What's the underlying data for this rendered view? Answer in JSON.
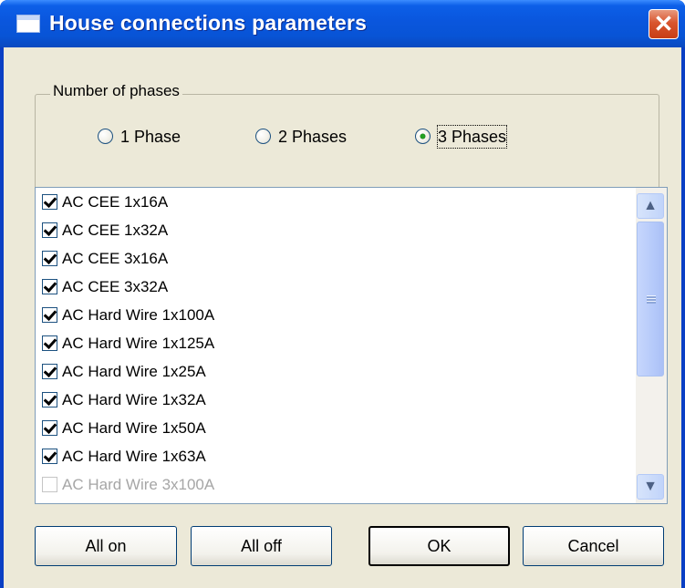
{
  "window": {
    "title": "House connections parameters",
    "close_glyph": "✕",
    "icon": "window-app-icon"
  },
  "phases": {
    "legend": "Number of phases",
    "options": [
      {
        "label": "1 Phase",
        "checked": false
      },
      {
        "label": "2 Phases",
        "checked": false
      },
      {
        "label": "3 Phases",
        "checked": true
      }
    ]
  },
  "list": {
    "items": [
      {
        "label": "AC CEE 1x16A",
        "checked": true
      },
      {
        "label": "AC CEE 1x32A",
        "checked": true
      },
      {
        "label": "AC CEE 3x16A",
        "checked": true
      },
      {
        "label": "AC CEE 3x32A",
        "checked": true
      },
      {
        "label": "AC Hard Wire 1x100A",
        "checked": true
      },
      {
        "label": "AC Hard Wire 1x125A",
        "checked": true
      },
      {
        "label": "AC Hard Wire 1x25A",
        "checked": true
      },
      {
        "label": "AC Hard Wire 1x32A",
        "checked": true
      },
      {
        "label": "AC Hard Wire 1x50A",
        "checked": true
      },
      {
        "label": "AC Hard Wire 1x63A",
        "checked": true
      },
      {
        "label": "AC Hard Wire 3x100A",
        "checked": false,
        "disabled": true
      }
    ],
    "scroll_up_glyph": "▲",
    "scroll_down_glyph": "▼"
  },
  "buttons": {
    "all_on": "All on",
    "all_off": "All off",
    "ok": "OK",
    "cancel": "Cancel"
  }
}
